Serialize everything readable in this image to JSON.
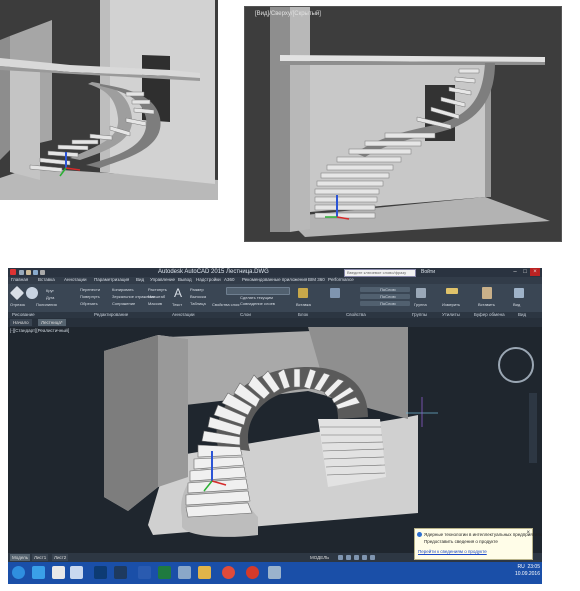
{
  "top_right_viewport": {
    "caption": "[Вид]/Сверху/[Скрытый]"
  },
  "autocad": {
    "title": "Autodesk AutoCAD 2015   Лестница.DWG",
    "search_placeholder": "Введите ключевое слово/фразу",
    "user_label": "Войти",
    "menu": [
      "Главная",
      "Вставка",
      "Аннотации",
      "Параметризация",
      "Вид",
      "Управление",
      "Вывод",
      "Надстройки",
      "A360",
      "Рекомендованные приложения",
      "BIM 360",
      "Performance"
    ],
    "ribbon": {
      "draw_items": [
        "Отрезок",
        "Полилиния",
        "Круг",
        "Дуга"
      ],
      "modify_items": [
        "Перенести",
        "Повернуть",
        "Обрезать",
        "Копировать",
        "Зеркальное отражение",
        "Сопряжение",
        "Растянуть",
        "Масштаб",
        "Массив"
      ],
      "annotation_items": [
        "Текст",
        "Размер",
        "Выноска",
        "Таблица"
      ],
      "layer_items": [
        "Свойства слоя",
        "Сделать текущим",
        "Совпадение слоев"
      ],
      "insert_label": "Вставка",
      "properties_items": [
        "ПоСлою",
        "ПоСлою",
        "ПоСлою"
      ],
      "groups_label": "Группа",
      "utilities_label": "Измерить",
      "clipboard_label": "Вставить",
      "view_label": "Вид"
    },
    "panels": [
      "Рисование",
      "Редактирование",
      "Аннотации",
      "Слои",
      "Блок",
      "Свойства",
      "Группы",
      "Утилиты",
      "Буфер обмена",
      "Вид"
    ],
    "doc_tabs": [
      "Начало",
      "Лестница*"
    ],
    "viewport_label": "[-][Стандарт][Реалистичный]",
    "status_tabs": [
      "Модель",
      "Лист1",
      "Лист2"
    ],
    "status_mode": "МОДЕЛЬ",
    "notification": {
      "line1": "Ядерные технологии в интеллектуальных предприятиях",
      "line2": "Предоставить сведения о продукте",
      "link": "Перейти к сведениям о продукте"
    },
    "tray": {
      "lang": "RU",
      "time": "23:05",
      "date": "10.09.2016"
    },
    "colors": {
      "canvas": "#1f262e",
      "ribbon": "#3a4654",
      "taskbar": "#1a4fa8",
      "stair": "#c9c9c9"
    },
    "taskbar_icons": [
      "windows-start-icon",
      "ie-icon",
      "autocad-icon",
      "explorer-icon",
      "photoshop-icon",
      "media-icon",
      "word-icon",
      "excel-icon",
      "calc-icon",
      "folder-icon",
      "chrome-icon",
      "yandex-icon",
      "app-icon"
    ]
  }
}
